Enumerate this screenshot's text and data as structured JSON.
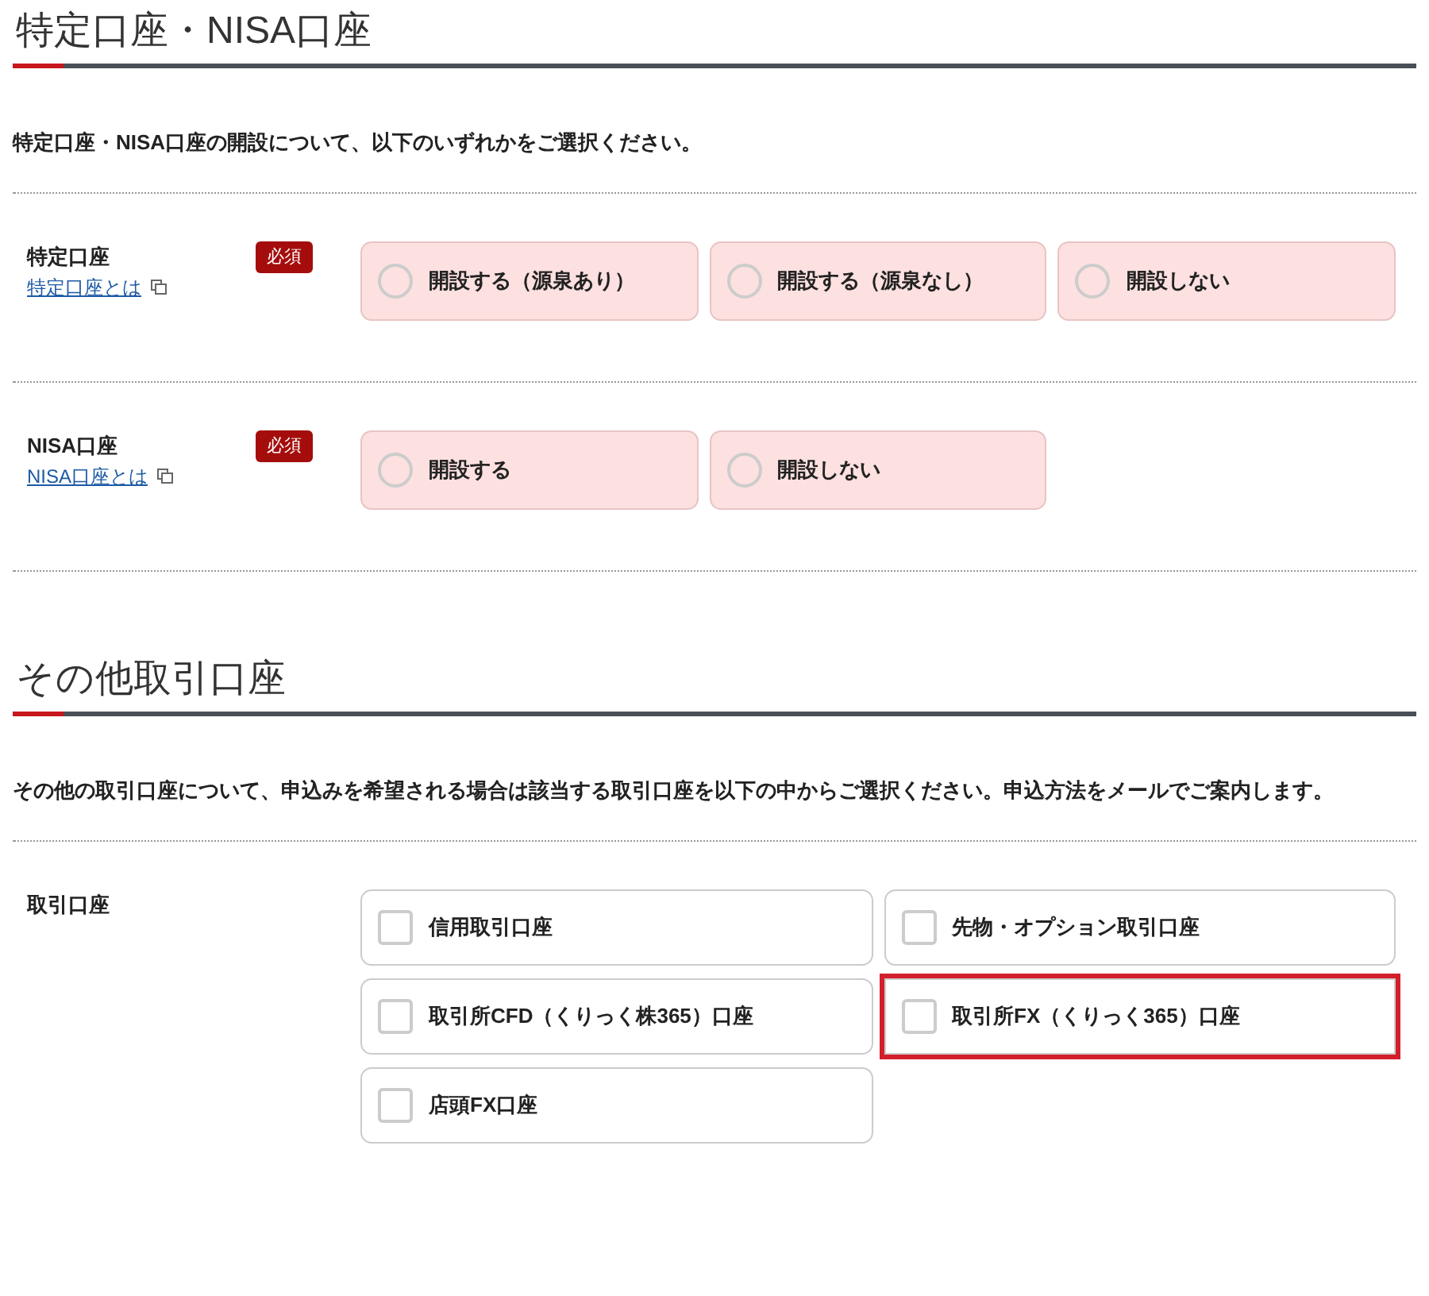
{
  "sections": [
    {
      "title": "特定口座・NISA口座",
      "intro": "特定口座・NISA口座の開設について、以下のいずれかをご選択ください。",
      "rows": [
        {
          "label": "特定口座",
          "link": "特定口座とは",
          "badge": "必須",
          "kind": "radio",
          "options": [
            {
              "label": "開設する（源泉あり）",
              "selected": false,
              "highlighted": false
            },
            {
              "label": "開設する（源泉なし）",
              "selected": false,
              "highlighted": false
            },
            {
              "label": "開設しない",
              "selected": false,
              "highlighted": false
            }
          ]
        },
        {
          "label": "NISA口座",
          "link": "NISA口座とは",
          "badge": "必須",
          "kind": "radio",
          "options": [
            {
              "label": "開設する",
              "selected": false,
              "highlighted": false
            },
            {
              "label": "開設しない",
              "selected": false,
              "highlighted": false
            }
          ]
        }
      ]
    },
    {
      "title": "その他取引口座",
      "intro": "その他の取引口座について、申込みを希望される場合は該当する取引口座を以下の中からご選択ください。申込方法をメールでご案内します。",
      "rows": [
        {
          "label": "取引口座",
          "kind": "checkbox",
          "options": [
            {
              "label": "信用取引口座",
              "checked": false,
              "highlighted": false
            },
            {
              "label": "先物・オプション取引口座",
              "checked": false,
              "highlighted": false
            },
            {
              "label": "取引所CFD（くりっく株365）口座",
              "checked": false,
              "highlighted": false
            },
            {
              "label": "取引所FX（くりっく365）口座",
              "checked": false,
              "highlighted": true
            },
            {
              "label": "店頭FX口座",
              "checked": false,
              "highlighted": false
            }
          ]
        }
      ]
    }
  ]
}
